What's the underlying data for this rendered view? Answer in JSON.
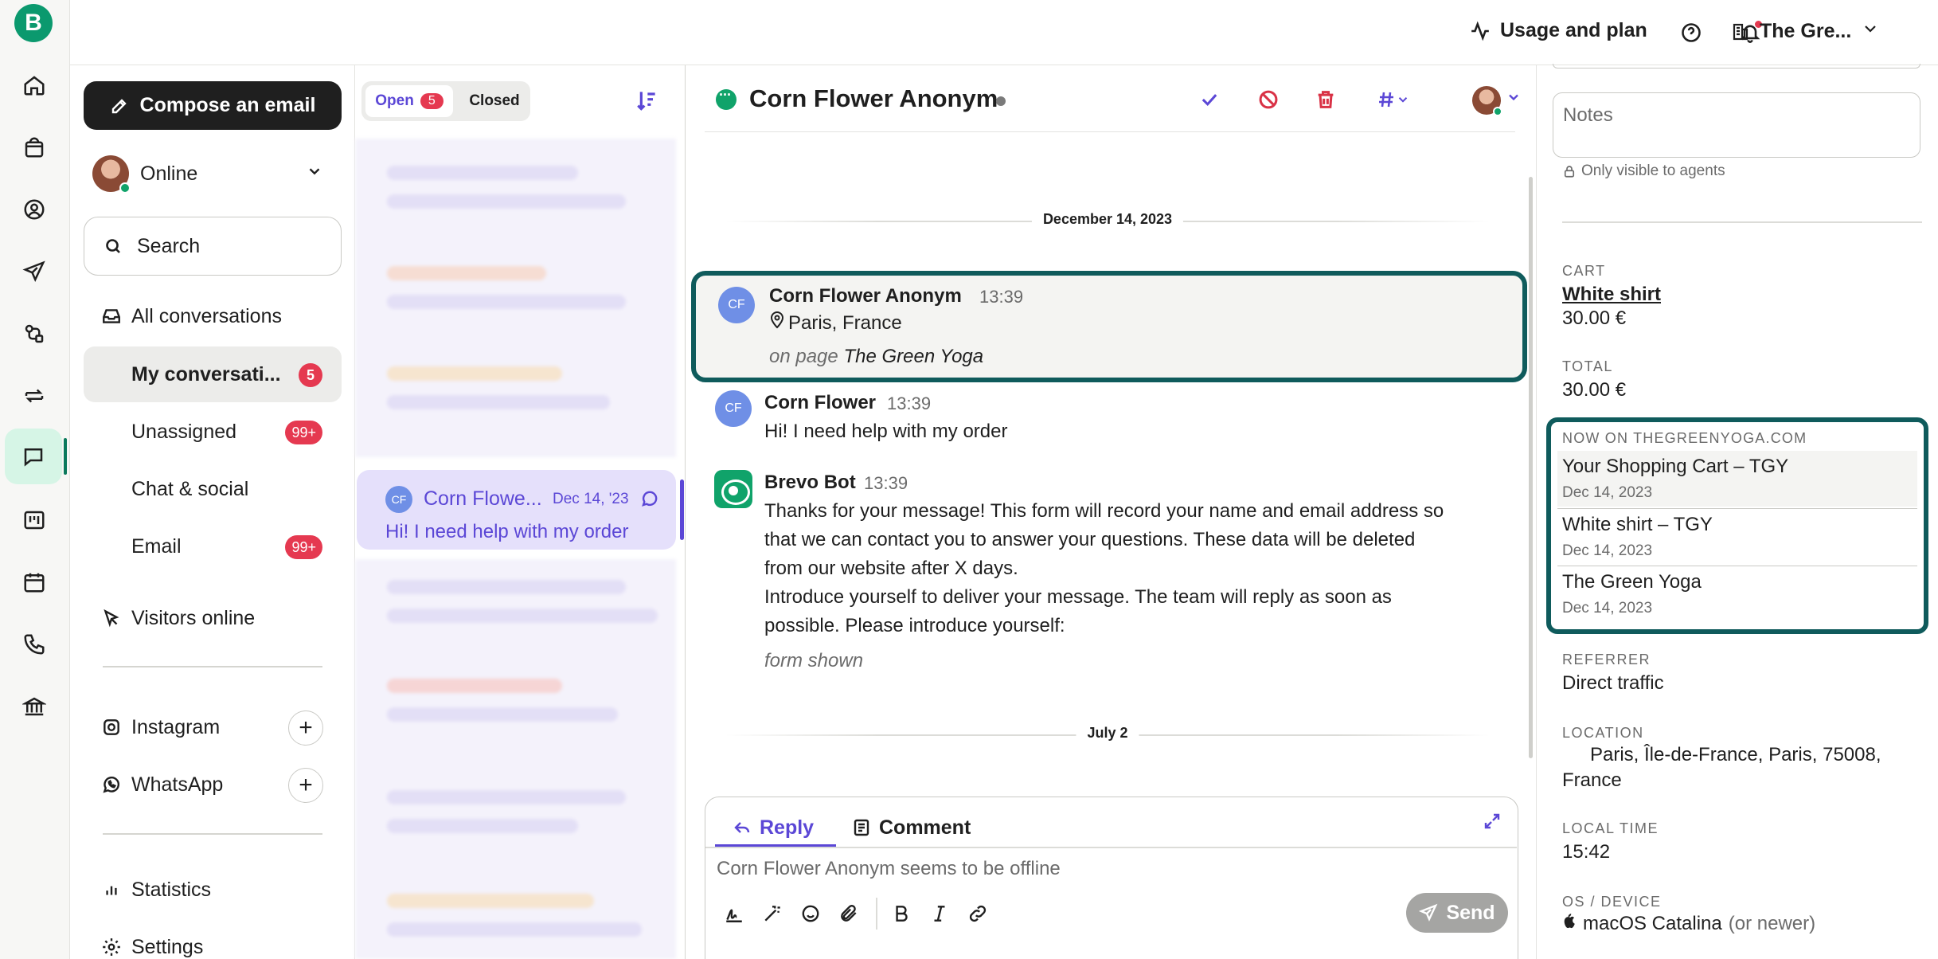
{
  "rail": {
    "logo_letter": "B",
    "icons": [
      "home-icon",
      "shopping-bag-icon",
      "contacts-icon",
      "send-icon",
      "automation-icon",
      "transactional-icon",
      "conversations-icon",
      "deals-icon",
      "calendar-icon",
      "phone-icon",
      "bank-icon"
    ]
  },
  "topbar": {
    "usage_label": "Usage and plan",
    "company_name": "The Gre..."
  },
  "nav": {
    "compose_label": "Compose an email",
    "status": "Online",
    "search_label": "Search",
    "all_conversations": "All conversations",
    "items": [
      {
        "label": "My conversati...",
        "badge": "5"
      },
      {
        "label": "Unassigned",
        "badge": "99+"
      },
      {
        "label": "Chat & social",
        "badge": ""
      },
      {
        "label": "Email",
        "badge": "99+"
      }
    ],
    "visitors_online": "Visitors online",
    "channels": [
      {
        "label": "Instagram",
        "icon": "instagram-icon"
      },
      {
        "label": "WhatsApp",
        "icon": "whatsapp-icon"
      }
    ],
    "statistics": "Statistics",
    "settings": "Settings"
  },
  "list": {
    "tab_open": "Open",
    "tab_open_count": "5",
    "tab_closed": "Closed",
    "selected": {
      "initials": "CF",
      "name": "Corn Flowe...",
      "date": "Dec 14, '23",
      "preview": "Hi! I need help with my order"
    }
  },
  "main": {
    "title": "Corn Flower Anonym",
    "date_1": "December 14, 2023",
    "date_2": "July 2",
    "messages": [
      {
        "initials": "CF",
        "name": "Corn Flower Anonym",
        "time": "13:39",
        "location": "Paris, France",
        "on_page_prefix": "on page",
        "on_page": "The Green Yoga"
      },
      {
        "initials": "CF",
        "name": "Corn Flower",
        "time": "13:39",
        "text": "Hi! I need help with my order"
      },
      {
        "name": "Brevo Bot",
        "time": "13:39",
        "lines": [
          "Thanks for your message! This form will record your name and email address so",
          "that we can contact you to answer your questions. These data will be deleted",
          "from our website after X days.",
          "Introduce yourself to deliver your message. The team will reply as soon as",
          "possible. Please introduce yourself:"
        ],
        "form_shown": "form shown"
      }
    ],
    "composer": {
      "reply_tab": "Reply",
      "comment_tab": "Comment",
      "placeholder": "Corn Flower Anonym seems to be offline",
      "send_label": "Send"
    }
  },
  "side": {
    "notes_placeholder": "Notes",
    "only_visible": "Only visible to agents",
    "cart_label": "CART",
    "cart_item": "White shirt",
    "cart_price": "30.00 €",
    "total_label": "TOTAL",
    "total_value": "30.00 €",
    "now_on_label": "NOW ON THEGREENYOGA.COM",
    "now_on": [
      {
        "title": "Your Shopping Cart – TGY",
        "date": "Dec 14, 2023"
      },
      {
        "title": "White shirt – TGY",
        "date": "Dec 14, 2023"
      },
      {
        "title": "The Green Yoga",
        "date": "Dec 14, 2023"
      }
    ],
    "referrer_label": "REFERRER",
    "referrer_value": "Direct traffic",
    "location_label": "LOCATION",
    "location_line1": "Paris, Île-de-France, Paris, 75008,",
    "location_line2": "France",
    "local_time_label": "LOCAL TIME",
    "local_time_value": "15:42",
    "os_label": "OS / DEVICE",
    "os_value": "macOS Catalina",
    "os_suffix": "(or newer)"
  },
  "colors": {
    "brand_green": "#0b996e",
    "accent_purple": "#5b47d6",
    "badge_red": "#e53950",
    "highlight_teal": "#0f5b5c"
  }
}
